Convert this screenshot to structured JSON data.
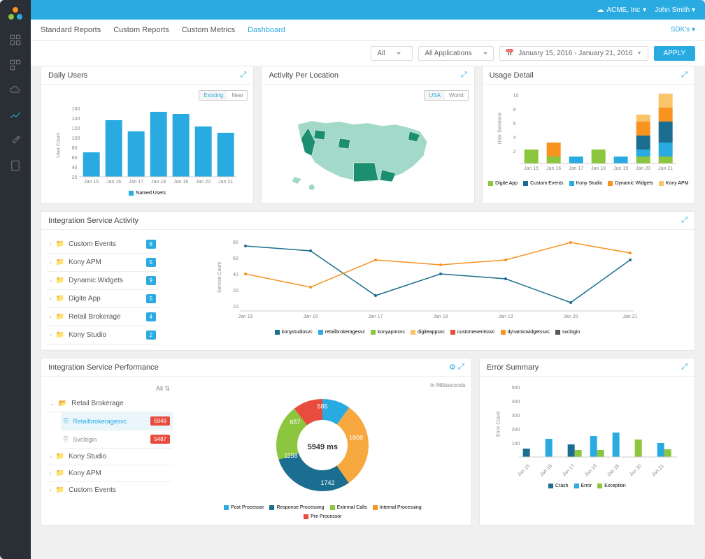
{
  "header": {
    "org": "ACME, Inc",
    "user": "John Smith"
  },
  "tabs": {
    "t0": "Standard Reports",
    "t1": "Custom Reports",
    "t2": "Custom Metrics",
    "t3": "Dashboard",
    "sdk": "SDK's"
  },
  "filters": {
    "all": "All",
    "apps": "All Applications",
    "date": "January 15, 2016 - January 21, 2016",
    "apply": "APPLY"
  },
  "daily": {
    "title": "Daily Users",
    "existing": "Existing",
    "new": "New",
    "legend": "Named Users",
    "ylabel": "User Count"
  },
  "loc": {
    "title": "Activity Per Location",
    "usa": "USA",
    "world": "World"
  },
  "usage": {
    "title": "Usage Detail",
    "ylabel": "User Sessions",
    "l0": "Digite App",
    "l1": "Custom Events",
    "l2": "Kony Studio",
    "l3": "Dynamic Widgets",
    "l4": "Kony APM"
  },
  "isa": {
    "title": "Integration Service Activity",
    "ylabel": "Service Count",
    "items": {
      "i0": "Custom Events",
      "i1": "Kony APM",
      "i2": "Dynamic Widgets",
      "i3": "Digite App",
      "i4": "Retail Brokerage",
      "i5": "Kony Studio"
    },
    "counts": {
      "c0": "6",
      "c1": "5",
      "c2": "9",
      "c3": "5",
      "c4": "4",
      "c5": "2"
    },
    "legends": {
      "l0": "konystudiosvc",
      "l1": "retailbrokeragesvc",
      "l2": "konyapmsvc",
      "l3": "digiteappsvc",
      "l4": "customeventssvc",
      "l5": "dynamicwidgetssvc",
      "l6": "svclogin"
    }
  },
  "isp": {
    "title": "Integration Service Performance",
    "all": "All",
    "unit": "In Miliseconds",
    "tree": {
      "t0": "Retail Brokerage",
      "t0a": "Retailbrokeragesvc",
      "t0av": "5949",
      "t0b": "Svclogin",
      "t0bv": "5487",
      "t1": "Kony Studio",
      "t2": "Kony APM",
      "t3": "Custom Events"
    },
    "center": "5949 ms",
    "seg": {
      "s0": "585",
      "s1": "1808",
      "s2": "1742",
      "s3": "1158",
      "s4": "657"
    },
    "legends": {
      "l0": "Post Processor",
      "l1": "Response Processing",
      "l2": "External Calls",
      "l3": "Internal Processing",
      "l4": "Pre Processor"
    }
  },
  "err": {
    "title": "Error Summary",
    "ylabel": "Error Count",
    "l0": "Crash",
    "l1": "Error",
    "l2": "Exception"
  },
  "xticks": {
    "x0": "Jan 15",
    "x1": "Jan 16",
    "x2": "Jan 17",
    "x3": "Jan 18",
    "x4": "Jan 19",
    "x5": "Jan 20",
    "x6": "Jan 21"
  },
  "chart_data": [
    {
      "type": "bar",
      "title": "Daily Users",
      "ylabel": "User Count",
      "ylim": [
        0,
        160
      ],
      "categories": [
        "Jan 15",
        "Jan 16",
        "Jan 17",
        "Jan 18",
        "Jan 19",
        "Jan 20",
        "Jan 21"
      ],
      "series": [
        {
          "name": "Named Users",
          "values": [
            60,
            135,
            110,
            155,
            150,
            120,
            105
          ]
        }
      ]
    },
    {
      "type": "map",
      "title": "Activity Per Location",
      "region": "USA"
    },
    {
      "type": "bar_stacked",
      "title": "Usage Detail",
      "ylabel": "User Sessions",
      "ylim": [
        0,
        10
      ],
      "categories": [
        "Jan 15",
        "Jan 16",
        "Jan 17",
        "Jan 18",
        "Jan 19",
        "Jan 20",
        "Jan 21"
      ],
      "series": [
        {
          "name": "Digite App",
          "color": "#8cc63f",
          "values": [
            2,
            1,
            0,
            2,
            0,
            1,
            1
          ]
        },
        {
          "name": "Custom Events",
          "color": "#1b6e8f",
          "values": [
            0,
            0,
            0,
            0,
            0,
            2,
            3
          ]
        },
        {
          "name": "Kony Studio",
          "color": "#29abe2",
          "values": [
            0,
            0,
            1,
            0,
            1,
            1,
            2
          ]
        },
        {
          "name": "Dynamic Widgets",
          "color": "#f7931e",
          "values": [
            0,
            2,
            0,
            0,
            0,
            2,
            2
          ]
        },
        {
          "name": "Kony APM",
          "color": "#f9c56b",
          "values": [
            0,
            0,
            0,
            0,
            0,
            1,
            2
          ]
        }
      ]
    },
    {
      "type": "line",
      "title": "Integration Service Activity",
      "ylabel": "Service Count",
      "ylim": [
        0,
        80
      ],
      "x": [
        "Jan 15",
        "Jan 16",
        "Jan 17",
        "Jan 18",
        "Jan 19",
        "Jan 20",
        "Jan 21"
      ],
      "series": [
        {
          "name": "konystudiosvc",
          "color": "#1b6e8f",
          "values": [
            75,
            68,
            20,
            45,
            40,
            12,
            60
          ]
        },
        {
          "name": "retailbrokeragesvc",
          "color": "#f7931e",
          "values": [
            45,
            30,
            60,
            55,
            60,
            82,
            70
          ]
        }
      ]
    },
    {
      "type": "pie",
      "title": "Integration Service Performance",
      "unit": "ms",
      "total": 5949,
      "slices": [
        {
          "name": "Post Processor",
          "value": 585,
          "color": "#29abe2"
        },
        {
          "name": "Response Processing",
          "value": 1808,
          "color": "#f7a93f"
        },
        {
          "name": "External Calls",
          "value": 1742,
          "color": "#1b6e8f"
        },
        {
          "name": "Internal Processing",
          "value": 1158,
          "color": "#8cc63f"
        },
        {
          "name": "Pre Processor",
          "value": 657,
          "color": "#e74c3c"
        }
      ]
    },
    {
      "type": "bar_grouped",
      "title": "Error Summary",
      "ylabel": "Error Count",
      "ylim": [
        0,
        500
      ],
      "categories": [
        "Jan 15",
        "Jan 16",
        "Jan 17",
        "Jan 18",
        "Jan 19",
        "Jan 20",
        "Jan 21"
      ],
      "series": [
        {
          "name": "Crash",
          "color": "#1b6e8f",
          "values": [
            60,
            0,
            90,
            0,
            0,
            0,
            0
          ]
        },
        {
          "name": "Error",
          "color": "#29abe2",
          "values": [
            0,
            130,
            0,
            150,
            175,
            0,
            100
          ]
        },
        {
          "name": "Exception",
          "color": "#8cc63f",
          "values": [
            0,
            0,
            50,
            50,
            0,
            125,
            55
          ]
        }
      ]
    }
  ]
}
